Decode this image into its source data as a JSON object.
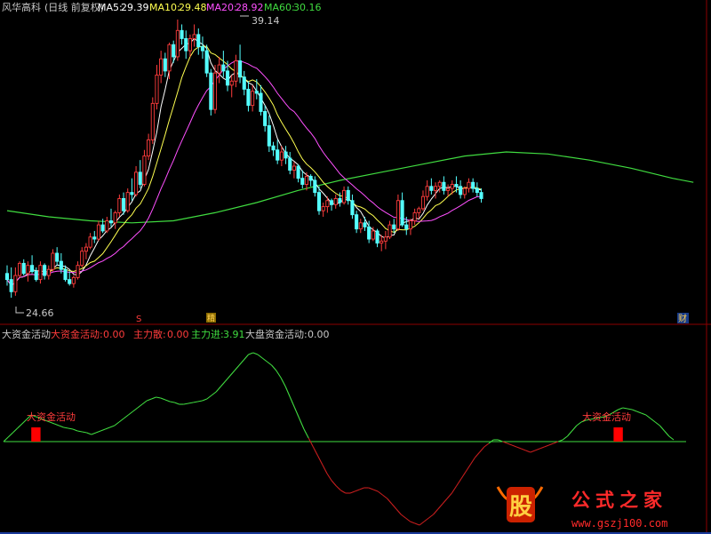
{
  "header": {
    "stock": "风华高科",
    "period": "(日线 前复权)",
    "ma5_label": "MA5:",
    "ma5_value": "29.39",
    "ma10_label": "MA10:",
    "ma10_value": "29.48",
    "ma20_label": "MA20:",
    "ma20_value": "28.92",
    "ma60_label": "MA60:",
    "ma60_value": "30.16"
  },
  "indicator_header": {
    "name": "大资金活动",
    "a_label": "大资金活动:",
    "a_value": "0.00",
    "b_label": "主力散:",
    "b_value": "0.00",
    "c_label": "主力进:",
    "c_value": "3.91",
    "d_label": "大盘资金活动:",
    "d_value": "0.00"
  },
  "markers": {
    "s": "S",
    "yellow": "精",
    "right": "财"
  },
  "watermark": {
    "logo": "股",
    "text": "公式之家",
    "site": "www.gszj100.com"
  },
  "colors": {
    "up": "#ff3c3c",
    "down": "#54ffff",
    "ma5": "#ffffff",
    "ma10": "#ffff50",
    "ma20": "#ff50ff",
    "ma60": "#40dc40",
    "activity": "#ff0000",
    "line_pos": "#40dc40",
    "line_neg": "#c81e1e",
    "frame": "#8b0000"
  },
  "chart_data": [
    {
      "type": "candlestick",
      "title": "风华高科 (日线 前复权)",
      "annotations": [
        {
          "label": "39.14",
          "at": "high"
        },
        {
          "label": "24.66",
          "at": "low"
        }
      ],
      "price_range": [
        24.66,
        39.14
      ],
      "candles": [
        [
          26.6,
          27.0,
          26.0,
          26.3
        ],
        [
          26.3,
          26.9,
          25.4,
          25.7
        ],
        [
          25.7,
          26.9,
          25.5,
          26.5
        ],
        [
          26.5,
          27.2,
          26.4,
          27.1
        ],
        [
          27.1,
          27.3,
          26.5,
          26.6
        ],
        [
          26.6,
          27.2,
          26.2,
          27.0
        ],
        [
          27.0,
          27.5,
          26.6,
          26.7
        ],
        [
          26.7,
          26.9,
          26.2,
          26.3
        ],
        [
          26.3,
          27.2,
          26.1,
          27.0
        ],
        [
          27.0,
          27.1,
          26.3,
          26.5
        ],
        [
          26.5,
          27.0,
          26.3,
          26.8
        ],
        [
          26.8,
          27.8,
          26.7,
          27.6
        ],
        [
          27.6,
          27.9,
          27.0,
          27.2
        ],
        [
          27.2,
          27.6,
          26.6,
          26.8
        ],
        [
          26.8,
          27.0,
          26.2,
          26.3
        ],
        [
          26.3,
          26.7,
          26.0,
          26.1
        ],
        [
          26.1,
          26.5,
          25.9,
          26.4
        ],
        [
          26.4,
          27.2,
          26.3,
          27.0
        ],
        [
          27.0,
          27.9,
          26.9,
          27.7
        ],
        [
          27.7,
          28.1,
          27.3,
          27.9
        ],
        [
          27.9,
          28.6,
          27.8,
          28.4
        ],
        [
          28.4,
          28.7,
          28.1,
          28.3
        ],
        [
          28.3,
          29.2,
          28.2,
          29.0
        ],
        [
          29.0,
          29.3,
          28.6,
          28.7
        ],
        [
          28.7,
          29.4,
          28.6,
          29.2
        ],
        [
          29.2,
          29.8,
          28.9,
          29.1
        ],
        [
          29.1,
          29.7,
          28.8,
          29.6
        ],
        [
          29.6,
          30.5,
          29.4,
          30.3
        ],
        [
          30.3,
          30.6,
          29.5,
          29.7
        ],
        [
          29.7,
          30.8,
          29.6,
          30.6
        ],
        [
          30.6,
          31.3,
          30.2,
          30.5
        ],
        [
          30.5,
          31.9,
          30.4,
          31.6
        ],
        [
          31.6,
          32.2,
          30.8,
          31.0
        ],
        [
          31.0,
          32.7,
          30.9,
          32.4
        ],
        [
          32.4,
          33.5,
          32.2,
          33.2
        ],
        [
          33.2,
          35.3,
          33.0,
          35.0
        ],
        [
          35.0,
          36.9,
          34.7,
          36.4
        ],
        [
          36.4,
          37.6,
          36.0,
          37.2
        ],
        [
          37.2,
          37.5,
          36.3,
          36.6
        ],
        [
          36.6,
          38.0,
          36.2,
          37.9
        ],
        [
          37.9,
          38.1,
          37.0,
          37.3
        ],
        [
          37.3,
          39.14,
          37.1,
          38.6
        ],
        [
          38.6,
          38.9,
          37.9,
          38.2
        ],
        [
          38.2,
          38.6,
          37.2,
          37.6
        ],
        [
          37.6,
          38.4,
          37.3,
          38.2
        ],
        [
          38.2,
          38.9,
          37.8,
          38.4
        ],
        [
          38.4,
          38.7,
          37.4,
          37.8
        ],
        [
          37.8,
          38.3,
          37.2,
          37.6
        ],
        [
          37.6,
          37.9,
          36.3,
          36.5
        ],
        [
          36.5,
          36.7,
          34.4,
          34.7
        ],
        [
          34.7,
          36.9,
          34.5,
          36.5
        ],
        [
          36.5,
          37.3,
          36.0,
          36.9
        ],
        [
          36.9,
          37.6,
          36.3,
          36.6
        ],
        [
          36.6,
          37.1,
          35.6,
          35.9
        ],
        [
          35.9,
          36.4,
          35.3,
          36.1
        ],
        [
          36.1,
          37.4,
          35.8,
          37.1
        ],
        [
          37.1,
          37.9,
          36.0,
          36.3
        ],
        [
          36.3,
          36.6,
          35.4,
          35.7
        ],
        [
          35.7,
          36.1,
          34.6,
          34.9
        ],
        [
          34.9,
          35.9,
          34.6,
          35.6
        ],
        [
          35.6,
          36.2,
          35.2,
          35.5
        ],
        [
          35.5,
          35.9,
          34.4,
          34.6
        ],
        [
          34.6,
          34.9,
          33.6,
          33.9
        ],
        [
          33.9,
          34.4,
          32.6,
          32.9
        ],
        [
          32.9,
          33.1,
          32.4,
          32.7
        ],
        [
          32.7,
          33.2,
          32.0,
          32.2
        ],
        [
          32.2,
          32.9,
          31.9,
          32.6
        ],
        [
          32.6,
          32.9,
          32.0,
          32.3
        ],
        [
          32.3,
          32.6,
          31.5,
          31.7
        ],
        [
          31.7,
          32.1,
          31.3,
          31.9
        ],
        [
          31.9,
          32.0,
          31.1,
          31.3
        ],
        [
          31.3,
          31.7,
          30.8,
          31.0
        ],
        [
          31.0,
          31.6,
          30.7,
          31.4
        ],
        [
          31.4,
          31.5,
          30.9,
          31.2
        ],
        [
          31.2,
          31.4,
          30.4,
          30.6
        ],
        [
          30.6,
          30.9,
          29.5,
          29.7
        ],
        [
          29.7,
          30.1,
          29.4,
          29.9
        ],
        [
          29.9,
          30.4,
          29.6,
          30.2
        ],
        [
          30.2,
          30.3,
          29.7,
          30.0
        ],
        [
          30.0,
          30.5,
          29.8,
          30.3
        ],
        [
          30.3,
          30.6,
          29.9,
          30.1
        ],
        [
          30.1,
          30.9,
          30.0,
          30.7
        ],
        [
          30.7,
          30.9,
          30.0,
          30.2
        ],
        [
          30.2,
          30.5,
          29.3,
          29.5
        ],
        [
          29.5,
          29.7,
          28.6,
          28.8
        ],
        [
          28.8,
          29.3,
          28.6,
          29.1
        ],
        [
          29.1,
          29.4,
          28.7,
          28.9
        ],
        [
          28.9,
          29.2,
          28.1,
          28.3
        ],
        [
          28.3,
          28.9,
          28.2,
          28.7
        ],
        [
          28.7,
          28.8,
          27.9,
          28.1
        ],
        [
          28.1,
          28.5,
          27.7,
          28.2
        ],
        [
          28.2,
          28.7,
          27.8,
          28.4
        ],
        [
          28.4,
          29.2,
          28.3,
          29.0
        ],
        [
          29.0,
          29.3,
          28.6,
          28.8
        ],
        [
          28.8,
          30.5,
          28.7,
          30.2
        ],
        [
          30.2,
          30.6,
          28.9,
          29.0
        ],
        [
          29.0,
          29.4,
          28.5,
          28.8
        ],
        [
          28.8,
          29.3,
          28.5,
          29.2
        ],
        [
          29.2,
          29.8,
          29.0,
          29.6
        ],
        [
          29.6,
          29.9,
          29.3,
          29.8
        ],
        [
          29.8,
          30.7,
          29.7,
          30.4
        ],
        [
          30.4,
          31.2,
          30.2,
          30.9
        ],
        [
          30.9,
          31.3,
          30.5,
          30.7
        ],
        [
          30.7,
          31.1,
          30.3,
          30.9
        ],
        [
          30.9,
          31.2,
          30.6,
          31.1
        ],
        [
          31.1,
          31.4,
          30.5,
          30.7
        ],
        [
          30.7,
          31.0,
          30.4,
          30.8
        ],
        [
          30.8,
          31.2,
          30.5,
          31.0
        ],
        [
          31.0,
          31.4,
          30.6,
          30.9
        ],
        [
          30.9,
          31.2,
          30.3,
          30.5
        ],
        [
          30.5,
          30.9,
          30.3,
          30.8
        ],
        [
          30.8,
          31.3,
          30.6,
          31.1
        ],
        [
          31.1,
          31.3,
          30.6,
          30.8
        ],
        [
          30.8,
          31.1,
          30.4,
          30.6
        ],
        [
          30.6,
          30.8,
          30.1,
          30.3
        ]
      ],
      "ma60": [
        [
          0,
          29.7
        ],
        [
          10,
          29.4
        ],
        [
          20,
          29.2
        ],
        [
          30,
          29.1
        ],
        [
          40,
          29.2
        ],
        [
          50,
          29.6
        ],
        [
          60,
          30.1
        ],
        [
          70,
          30.7
        ],
        [
          80,
          31.2
        ],
        [
          90,
          31.6
        ],
        [
          100,
          32.0
        ],
        [
          110,
          32.4
        ],
        [
          120,
          32.6
        ],
        [
          130,
          32.5
        ],
        [
          140,
          32.2
        ],
        [
          150,
          31.8
        ],
        [
          160,
          31.3
        ],
        [
          165,
          31.1
        ]
      ]
    },
    {
      "type": "line",
      "title": "大资金活动",
      "series": [
        {
          "name": "主力进",
          "y": [
            0.0,
            0.05,
            0.1,
            0.15,
            0.2,
            0.25,
            0.3,
            0.28,
            0.26,
            0.24,
            0.22,
            0.2,
            0.18,
            0.16,
            0.15,
            0.14,
            0.12,
            0.11,
            0.1,
            0.08,
            0.1,
            0.12,
            0.14,
            0.16,
            0.18,
            0.22,
            0.26,
            0.3,
            0.34,
            0.38,
            0.42,
            0.46,
            0.48,
            0.5,
            0.49,
            0.47,
            0.45,
            0.44,
            0.42,
            0.42,
            0.43,
            0.44,
            0.45,
            0.46,
            0.48,
            0.52,
            0.56,
            0.62,
            0.68,
            0.74,
            0.8,
            0.86,
            0.92,
            0.98,
            1.0,
            0.98,
            0.94,
            0.9,
            0.86,
            0.8,
            0.72,
            0.62,
            0.5,
            0.38,
            0.26,
            0.14,
            0.04,
            -0.06,
            -0.16,
            -0.26,
            -0.36,
            -0.44,
            -0.5,
            -0.55,
            -0.58,
            -0.58,
            -0.56,
            -0.54,
            -0.52,
            -0.52,
            -0.54,
            -0.56,
            -0.6,
            -0.64,
            -0.7,
            -0.76,
            -0.82,
            -0.86,
            -0.9,
            -0.92,
            -0.94,
            -0.9,
            -0.86,
            -0.82,
            -0.76,
            -0.7,
            -0.64,
            -0.58,
            -0.5,
            -0.42,
            -0.34,
            -0.26,
            -0.18,
            -0.12,
            -0.06,
            -0.02,
            0.02,
            0.02,
            0.0,
            -0.02,
            -0.04,
            -0.06,
            -0.08,
            -0.1,
            -0.12,
            -0.1,
            -0.08,
            -0.06,
            -0.04,
            -0.02,
            0.0,
            0.02,
            0.06,
            0.12,
            0.18,
            0.22,
            0.24,
            0.25,
            0.26,
            0.27,
            0.28,
            0.3,
            0.33,
            0.36,
            0.38,
            0.37,
            0.36,
            0.34,
            0.32,
            0.3,
            0.26,
            0.22,
            0.18,
            0.12,
            0.06,
            0.02
          ]
        },
        {
          "name": "大资金活动",
          "bars": [
            [
              6,
              8,
              0.16
            ],
            [
              132,
              134,
              0.16
            ]
          ]
        }
      ]
    }
  ]
}
